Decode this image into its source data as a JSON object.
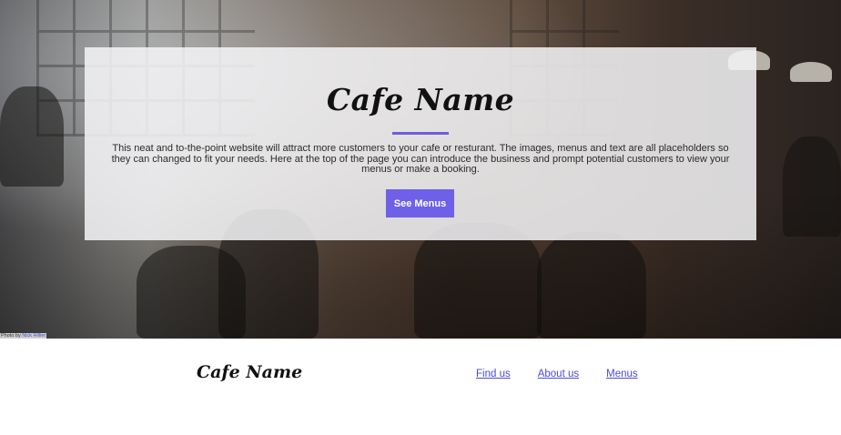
{
  "hero": {
    "title": "Cafe Name",
    "description": "This neat and to-the-point website will attract more customers to your cafe or resturant. The images, menus and text are all placeholders so they can changed to fit your needs. Here at the top of the page you can introduce the business and prompt potential customers to view your menus or make a booking.",
    "cta_label": "See Menus",
    "background_image": "cafe-interior-photo",
    "accent_color": "#6f60e8"
  },
  "photo_credit": {
    "prefix": "Photo by",
    "author": "Nick Hillier"
  },
  "footer": {
    "logo": "Cafe Name",
    "nav": [
      {
        "label": "Find us"
      },
      {
        "label": "About us"
      },
      {
        "label": "Menus"
      }
    ],
    "link_color": "#4b4ad6"
  }
}
